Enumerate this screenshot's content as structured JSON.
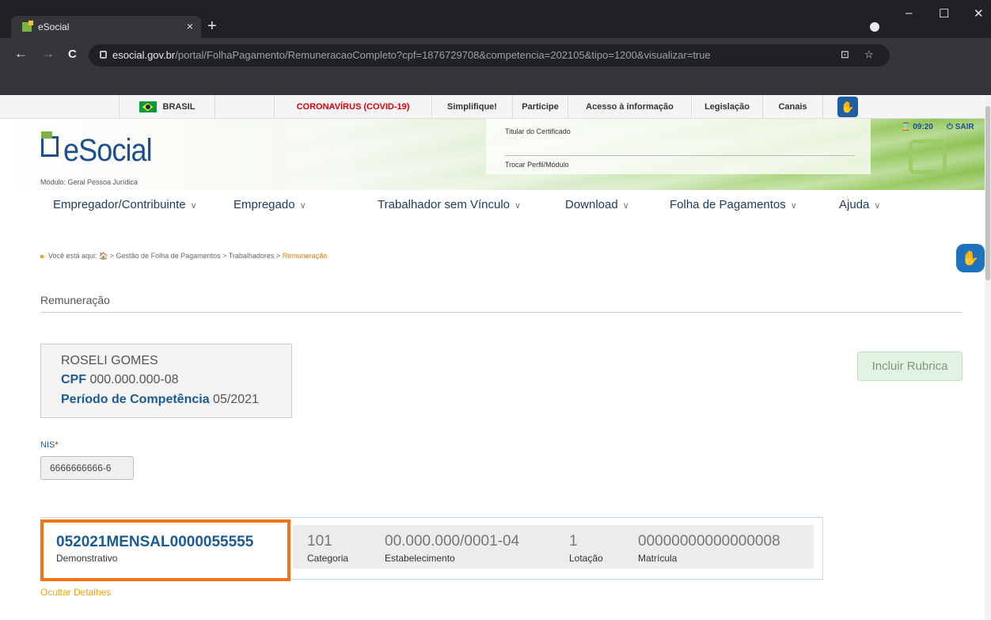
{
  "browser": {
    "tab_title": "eSocial",
    "tab_close": "×",
    "new_tab": "+",
    "url_host": "esocial.gov.br",
    "url_path": "/portal/FolhaPagamento/RemuneracaoCompleto?cpf=1876729708&competencia=202105&tipo=1200&visualizar=true",
    "back": "←",
    "forward": "→",
    "reload": "C",
    "translate_icon": "⊡",
    "star_icon": "☆",
    "minimize": "–",
    "maximize": "☐",
    "close": "✕"
  },
  "govbar": {
    "brasil": "BRASIL",
    "covid": "CORONAVÍRUS (COVID-19)",
    "simplifique": "Simplifique!",
    "participe": "Participe",
    "acesso": "Acesso à informação",
    "legislacao": "Legislação",
    "canais": "Canais"
  },
  "header": {
    "logo": "eSocial",
    "modulo": "Módulo: Geral Pessoa Jurídica",
    "titular_label": "Titular do Certificado",
    "trocar_perfil": "Trocar Perfil/Módulo",
    "timer": "⌛ 09:20",
    "sair": "⏻ SAIR"
  },
  "nav": {
    "items": [
      "Empregador/Contribuinte",
      "Empregado",
      "Trabalhador sem Vínculo",
      "Download",
      "Folha de Pagamentos",
      "Ajuda"
    ],
    "chevron": "∨"
  },
  "breadcrumb": {
    "prefix": "Você está aqui:",
    "home": "🏠",
    "path": " > Gestão de Folha de Pagamentos > Trabalhadores > ",
    "current": "Remuneração"
  },
  "section_title": "Remuneração",
  "person": {
    "name": "ROSELI GOMES",
    "cpf_label": "CPF",
    "cpf": "000.000.000-08",
    "periodo_label": "Período de Competência",
    "periodo": "05/2021"
  },
  "incluir_rubrica": "Incluir Rubrica",
  "nis": {
    "label": "NIS",
    "required": "*",
    "value": "6666666666-6"
  },
  "demonstrativo": {
    "code": "052021MENSAL0000055555",
    "label": "Demonstrativo",
    "categoria_value": "101",
    "categoria_label": "Categoria",
    "estabelecimento_value": "00.000.000/0001-04",
    "estabelecimento_label": "Estabelecimento",
    "lotacao_value": "1",
    "lotacao_label": "Lotação",
    "matricula_value": "00000000000000008",
    "matricula_label": "Matrícula"
  },
  "ocultar_detalhes": "Ocultar Detalhes",
  "colors": {
    "brand_blue": "#1b5a94",
    "highlight_orange": "#f47216",
    "covid_red": "#d8000c"
  }
}
